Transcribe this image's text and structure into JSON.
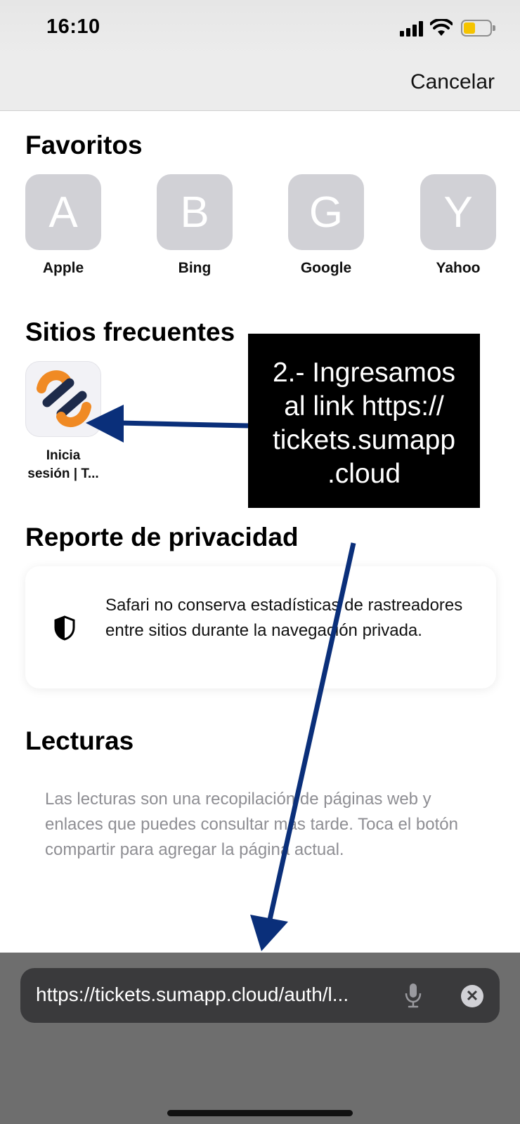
{
  "status_bar": {
    "time": "16:10"
  },
  "nav": {
    "cancel_label": "Cancelar"
  },
  "favorites": {
    "title": "Favoritos",
    "items": [
      {
        "letter": "A",
        "label": "Apple"
      },
      {
        "letter": "B",
        "label": "Bing"
      },
      {
        "letter": "G",
        "label": "Google"
      },
      {
        "letter": "Y",
        "label": "Yahoo"
      }
    ]
  },
  "frequent": {
    "title": "Sitios frecuentes",
    "items": [
      {
        "label_line1": "Inicia",
        "label_line2": "sesión | T..."
      }
    ]
  },
  "annotation": {
    "line1": "2.- Ingresamos",
    "line2": "al link https://",
    "line3": "tickets.sumapp",
    "line4": ".cloud",
    "color": "#0a2f7a"
  },
  "privacy": {
    "title": "Reporte de privacidad",
    "text": "Safari no conserva estadísticas de rastreadores entre sitios durante la navegación privada."
  },
  "reading": {
    "title": "Lecturas",
    "text": "Las lecturas son una recopilación de páginas web y enlaces que puedes consultar más tarde. Toca el botón compartir para agregar la página actual."
  },
  "url_bar": {
    "value": "https://tickets.sumapp.cloud/auth/l..."
  },
  "icons": {
    "signal": "signal-icon",
    "wifi": "wifi-icon",
    "battery": "battery-icon",
    "shield": "shield-icon",
    "mic": "microphone-icon",
    "clear": "clear-icon"
  }
}
